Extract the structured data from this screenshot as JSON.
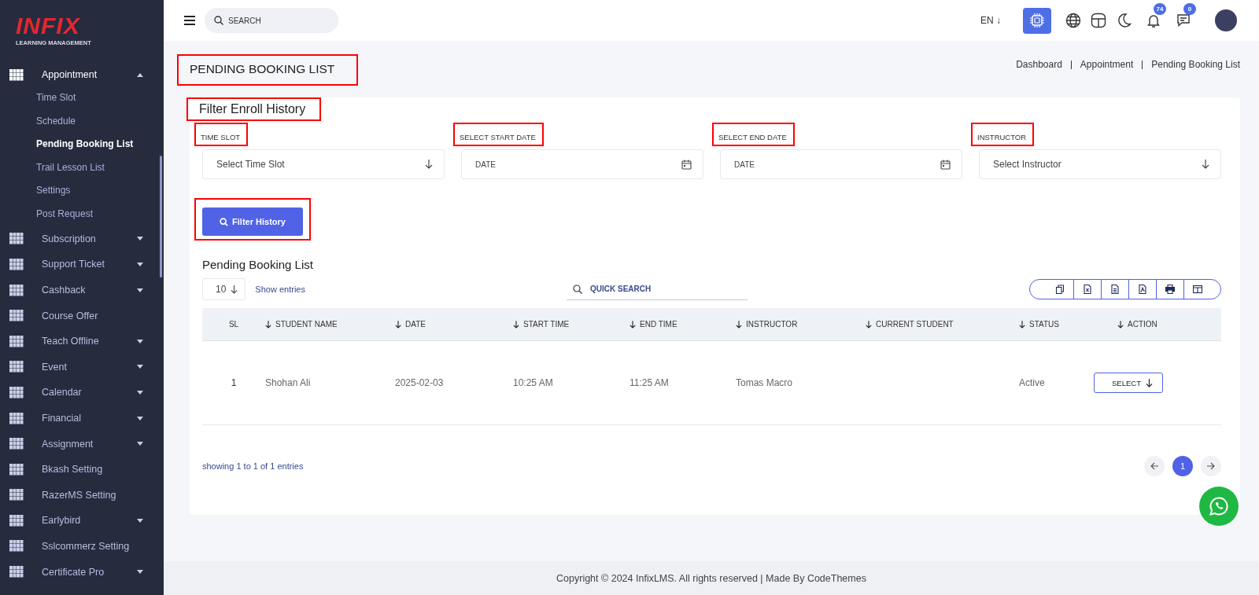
{
  "sidebar": {
    "logo": {
      "brand": "INFIX",
      "tagline": "LEARNING MANAGEMENT"
    },
    "items": [
      {
        "label": "Appointment",
        "expanded": true,
        "children": [
          {
            "label": "Time Slot",
            "selected": false
          },
          {
            "label": "Schedule",
            "selected": false
          },
          {
            "label": "Pending Booking List",
            "selected": true
          },
          {
            "label": "Trail Lesson List",
            "selected": false
          },
          {
            "label": "Settings",
            "selected": false
          },
          {
            "label": "Post Request",
            "selected": false
          }
        ]
      },
      {
        "label": "Subscription",
        "expanded": false
      },
      {
        "label": "Support Ticket",
        "expanded": false
      },
      {
        "label": "Cashback",
        "expanded": false
      },
      {
        "label": "Course Offer"
      },
      {
        "label": "Teach Offline",
        "expanded": false
      },
      {
        "label": "Event",
        "expanded": false
      },
      {
        "label": "Calendar",
        "expanded": false
      },
      {
        "label": "Financial",
        "expanded": false
      },
      {
        "label": "Assignment",
        "expanded": false
      },
      {
        "label": "Bkash Setting"
      },
      {
        "label": "RazerMS Setting"
      },
      {
        "label": "Earlybird",
        "expanded": false
      },
      {
        "label": "Sslcommerz Setting"
      },
      {
        "label": "Certificate Pro",
        "expanded": false
      }
    ]
  },
  "header": {
    "search": {
      "placeholder": "SEARCH"
    },
    "language": "EN ↓",
    "notifications": "74",
    "messages": "0"
  },
  "page": {
    "title": "PENDING BOOKING LIST",
    "title_highlighted": true,
    "breadcrumbs": [
      "Dashboard",
      "Appointment",
      "Pending Booking List"
    ]
  },
  "filter": {
    "title": "Filter Enroll History",
    "title_highlighted": true,
    "fields": [
      {
        "label": "TIME SLOT",
        "kind": "select",
        "placeholder": "Select Time Slot",
        "highlighted": true
      },
      {
        "label": "SELECT START DATE",
        "kind": "date",
        "placeholder": "DATE",
        "highlighted": true
      },
      {
        "label": "SELECT END DATE",
        "kind": "date",
        "placeholder": "DATE",
        "highlighted": true
      },
      {
        "label": "INSTRUCTOR",
        "kind": "select",
        "placeholder": "Select Instructor",
        "highlighted": true
      }
    ],
    "button": {
      "label": "Filter History",
      "highlighted": true
    }
  },
  "table": {
    "title": "Pending Booking List",
    "page_size": "10",
    "page_size_label": "Show entries",
    "search": {
      "placeholder": "QUICK SEARCH"
    },
    "exports": [
      {
        "kind": "copy"
      },
      {
        "kind": "excel"
      },
      {
        "kind": "csv"
      },
      {
        "kind": "pdf"
      },
      {
        "kind": "print"
      },
      {
        "kind": "columns"
      }
    ],
    "columns": [
      {
        "label": "SL",
        "sortable": false
      },
      {
        "label": "STUDENT NAME",
        "sortable": true
      },
      {
        "label": "DATE",
        "sortable": true
      },
      {
        "label": "START TIME",
        "sortable": true
      },
      {
        "label": "END TIME",
        "sortable": true
      },
      {
        "label": "INSTRUCTOR",
        "sortable": true
      },
      {
        "label": "CURRENT STUDENT",
        "sortable": true
      },
      {
        "label": "STATUS",
        "sortable": true
      },
      {
        "label": "ACTION",
        "sortable": true
      }
    ],
    "rows": [
      {
        "cells": [
          "1",
          "Shohan Ali",
          "2025-02-03",
          "10:25 AM",
          "11:25 AM",
          "Tomas Macro",
          "",
          "Active"
        ],
        "action": "SELECT"
      }
    ],
    "info": "showing 1 to 1 of 1 entries",
    "pages": [
      {
        "label": "1",
        "selected": true
      }
    ]
  },
  "footer": "Copyright © 2024 InfixLMS. All rights reserved | Made By CodeThemes"
}
